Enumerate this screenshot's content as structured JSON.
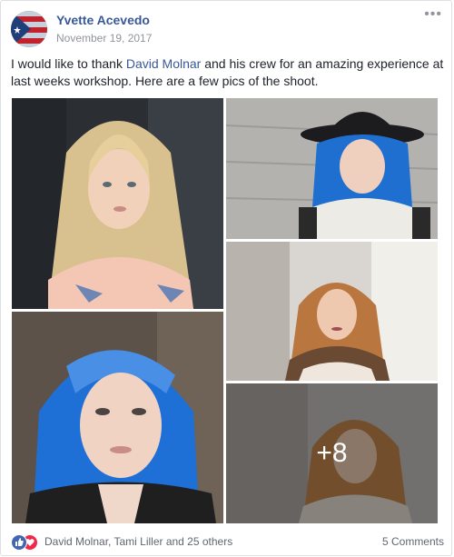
{
  "post": {
    "author": "Yvette Acevedo",
    "date": "November 19, 2017",
    "text_before": "I would like to thank ",
    "mention": "David Molnar",
    "text_after": " and his crew for an amazing experience at last weeks workshop. Here are a few pics of the shoot.",
    "more_icon": "ellipsis-icon"
  },
  "photos": {
    "more_count": "+8"
  },
  "footer": {
    "reactors": "David Molnar, Tami Liller and 25 others",
    "comments": "5 Comments"
  },
  "colors": {
    "link": "#385898",
    "like": "#4267b2",
    "love": "#f0284a"
  }
}
